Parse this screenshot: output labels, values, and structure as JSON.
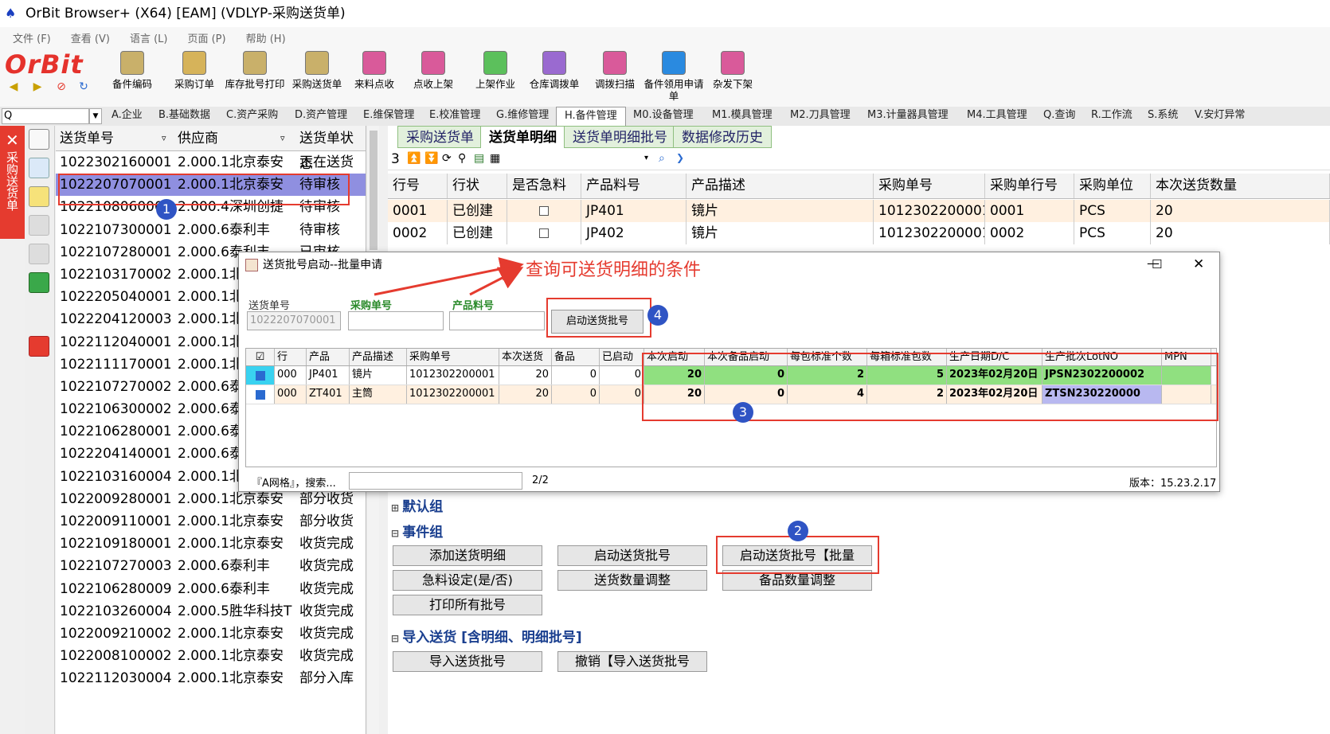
{
  "window": {
    "title": "OrBit Browser+ (X64) [EAM] (VDLYP-采购送货单)"
  },
  "menu": [
    "文件 (F)",
    "查看 (V)",
    "语言 (L)",
    "页面 (P)",
    "帮助 (H)"
  ],
  "logo": "OrBit",
  "toolbar": [
    {
      "label": "备件编码",
      "color": "#c9b06a"
    },
    {
      "label": "采购订单",
      "color": "#d6b35a"
    },
    {
      "label": "库存批号打印",
      "color": "#c9b06a"
    },
    {
      "label": "采购送货单",
      "color": "#c9b06a"
    },
    {
      "label": "来料点收",
      "color": "#d95a9a"
    },
    {
      "label": "点收上架",
      "color": "#d95a9a"
    },
    {
      "label": "上架作业",
      "color": "#5cc05c"
    },
    {
      "label": "仓库调拨单",
      "color": "#9a6ad0"
    },
    {
      "label": "调拨扫描",
      "color": "#d95a9a"
    },
    {
      "label": "备件领用申请单",
      "color": "#2a8ae0"
    },
    {
      "label": "杂发下架",
      "color": "#d95a9a"
    }
  ],
  "search": {
    "value": "Q"
  },
  "module_tabs": [
    "A.企业",
    "B.基础数据",
    "C.资产采购",
    "D.资产管理",
    "E.维保管理",
    "E.校准管理",
    "G.维修管理",
    "H.备件管理",
    "M0.设备管理",
    "M1.模具管理",
    "M2.刀具管理",
    "M3.计量器具管理",
    "M4.工具管理",
    "Q.查询",
    "R.工作流",
    "S.系统",
    "V.安灯异常"
  ],
  "side_label": "采购送货单",
  "left_grid": {
    "headers": [
      "送货单号",
      "供应商",
      "送货单状态"
    ],
    "rows": [
      [
        "1022302160001",
        "2.000.1",
        "北京泰安",
        "正在送货"
      ],
      [
        "1022207070001",
        "2.000.1",
        "北京泰安",
        "待审核"
      ],
      [
        "1022108060001",
        "2.000.4",
        "深圳创捷",
        "待审核"
      ],
      [
        "1022107300001",
        "2.000.6",
        "泰利丰",
        "待审核"
      ],
      [
        "1022107280001",
        "2.000.6",
        "泰利丰",
        "已审核"
      ],
      [
        "1022103170002",
        "2.000.1",
        "北京泰安",
        ""
      ],
      [
        "1022205040001",
        "2.000.1",
        "北京泰安",
        ""
      ],
      [
        "1022204120003",
        "2.000.1",
        "北京泰安",
        ""
      ],
      [
        "1022112040001",
        "2.000.1",
        "北京泰安",
        ""
      ],
      [
        "1022111170001",
        "2.000.1",
        "北京泰安",
        ""
      ],
      [
        "1022107270002",
        "2.000.6",
        "泰利丰",
        ""
      ],
      [
        "1022106300002",
        "2.000.6",
        "泰利丰",
        ""
      ],
      [
        "1022106280001",
        "2.000.6",
        "泰利丰",
        ""
      ],
      [
        "1022204140001",
        "2.000.6",
        "泰利丰",
        ""
      ],
      [
        "1022103160004",
        "2.000.1",
        "北京泰安",
        ""
      ],
      [
        "1022009280001",
        "2.000.1",
        "北京泰安",
        "部分收货"
      ],
      [
        "1022009110001",
        "2.000.1",
        "北京泰安",
        "部分收货"
      ],
      [
        "1022109180001",
        "2.000.1",
        "北京泰安",
        "收货完成"
      ],
      [
        "1022107270003",
        "2.000.6",
        "泰利丰",
        "收货完成"
      ],
      [
        "1022106280009",
        "2.000.6",
        "泰利丰",
        "收货完成"
      ],
      [
        "1022103260004",
        "2.000.5",
        "胜华科技T",
        "收货完成"
      ],
      [
        "1022009210002",
        "2.000.1",
        "北京泰安",
        "收货完成"
      ],
      [
        "1022008100002",
        "2.000.1",
        "北京泰安",
        "收货完成"
      ],
      [
        "1022112030004",
        "2.000.1",
        "北京泰安",
        "部分入库"
      ]
    ]
  },
  "right_tabs": [
    "采购送货单",
    "送货单明细",
    "送货单明细批号",
    "数据修改历史"
  ],
  "right_toolbar": {
    "count": "3"
  },
  "detail_grid": {
    "headers": [
      "行号",
      "行状",
      "是否急料",
      "产品料号",
      "产品描述",
      "采购单号",
      "采购单行号",
      "采购单位",
      "本次送货数量"
    ],
    "rows": [
      [
        "0001",
        "已创建",
        "",
        "JP401",
        "镜片",
        "1012302200001",
        "0001",
        "PCS",
        "20"
      ],
      [
        "0002",
        "已创建",
        "",
        "JP402",
        "镜片",
        "1012302200001",
        "0002",
        "PCS",
        "20"
      ]
    ]
  },
  "dialog": {
    "title": "送货批号启动--批量申请",
    "fields": {
      "delivery_no_label": "送货单号",
      "delivery_no_value": "1022207070001",
      "po_label": "采购单号",
      "part_label": "产品料号"
    },
    "start_button": "启动送货批号",
    "annotation": "查询可送货明细的条件",
    "grid": {
      "headers": [
        "行",
        "产品",
        "产品描述",
        "采购单号",
        "本次送货",
        "备品",
        "已启动",
        "本次启动",
        "本次备品启动",
        "每包标准个数",
        "每箱标准包数",
        "生产日期D/C",
        "生产批次LotNO",
        "MPN"
      ],
      "rows": [
        [
          "000",
          "JP401",
          "镜片",
          "1012302200001",
          "20",
          "0",
          "0",
          "20",
          "0",
          "2",
          "5",
          "2023年02月20日",
          "JPSN2302200002",
          ""
        ],
        [
          "000",
          "ZT401",
          "主筒",
          "1012302200001",
          "20",
          "0",
          "0",
          "20",
          "0",
          "4",
          "2",
          "2023年02月20日",
          "ZTSN230220000",
          ""
        ]
      ]
    },
    "footer": {
      "filter_label": "『A网格』，搜索...",
      "page": "2/2",
      "version": "版本：15.23.2.17"
    }
  },
  "groups": {
    "default": "默认组",
    "events": "事件组",
    "event_buttons": [
      "添加送货明细",
      "启动送货批号",
      "启动送货批号【批量",
      "急料设定(是/否)",
      "送货数量调整",
      "备品数量调整",
      "打印所有批号"
    ],
    "import": "导入送货 [含明细、明细批号]",
    "import_buttons": [
      "导入送货批号",
      "撤销【导入送货批号"
    ]
  },
  "badges": [
    "1",
    "2",
    "3",
    "4"
  ]
}
